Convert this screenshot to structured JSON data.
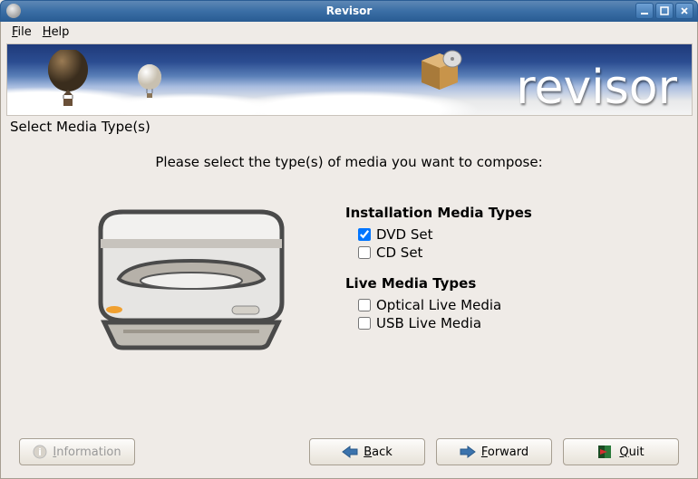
{
  "window": {
    "title": "Revisor"
  },
  "menubar": {
    "file": "File",
    "help": "Help"
  },
  "banner": {
    "brand": "revisor"
  },
  "section_label": "Select Media Type(s)",
  "instruction": "Please select the type(s) of media you want to compose:",
  "groups": {
    "install": {
      "title": "Installation Media Types",
      "dvd": {
        "label": "DVD Set",
        "checked": true
      },
      "cd": {
        "label": "CD Set",
        "checked": false
      }
    },
    "live": {
      "title": "Live Media Types",
      "optical": {
        "label": "Optical Live Media",
        "checked": false
      },
      "usb": {
        "label": "USB Live Media",
        "checked": false
      }
    }
  },
  "buttons": {
    "information": "Information",
    "back": "Back",
    "forward": "Forward",
    "quit": "Quit"
  }
}
